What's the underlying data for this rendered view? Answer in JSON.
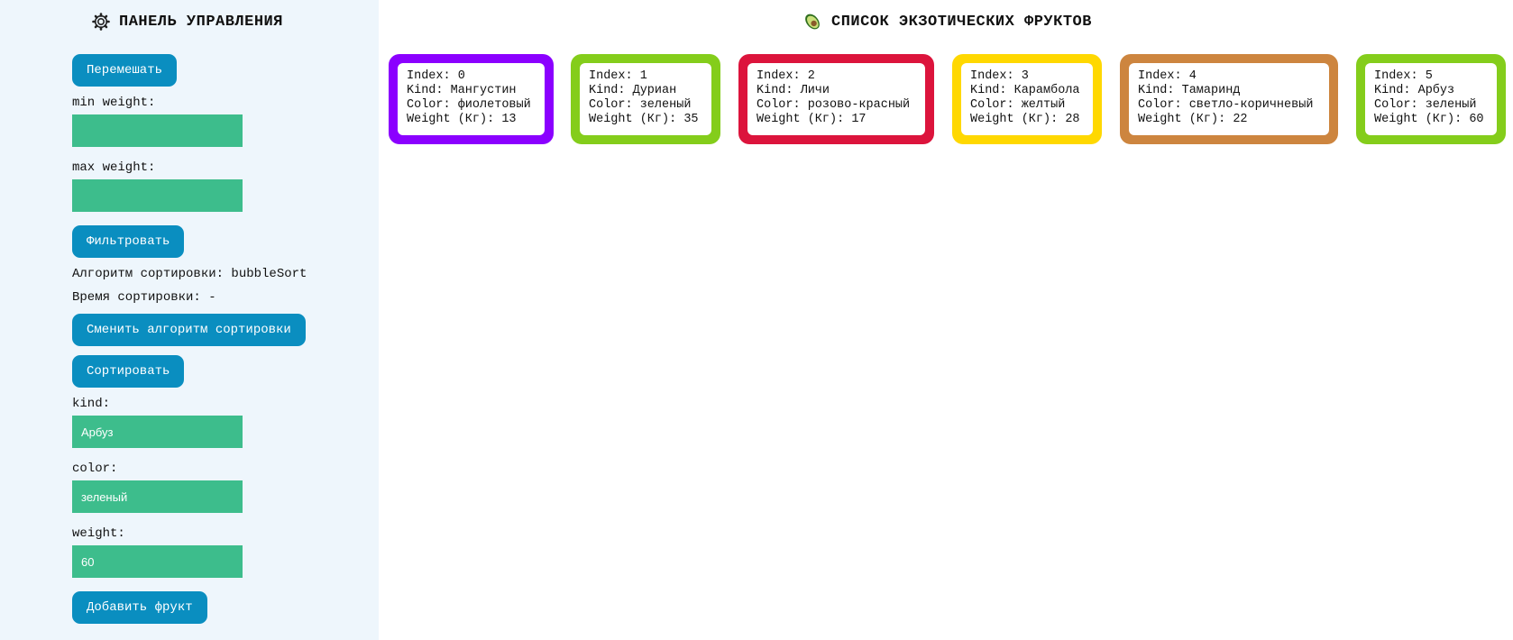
{
  "panel": {
    "title": "ПАНЕЛЬ УПРАВЛЕНИЯ",
    "icon": "gear-icon",
    "shuffle_label": "Перемешать",
    "min_weight_label": "min weight:",
    "min_weight_value": "",
    "max_weight_label": "max weight:",
    "max_weight_value": "",
    "filter_label": "Фильтровать",
    "algorithm_text": "Алгоритм сортировки: bubbleSort",
    "time_text": "Время сортировки: -",
    "change_algorithm_label": "Сменить алгоритм сортировки",
    "sort_label": "Сортировать",
    "kind_label": "kind:",
    "kind_value": "Арбуз",
    "color_label": "color:",
    "color_value": "зеленый",
    "weight_label": "weight:",
    "weight_value": "60",
    "add_label": "Добавить фрукт"
  },
  "main": {
    "title": "СПИСОК ЭКЗОТИЧЕСКИХ ФРУКТОВ",
    "icon": "avocado-icon"
  },
  "colors": {
    "button": "#0a8ec0",
    "input": "#3dbd8c",
    "panel_bg": "#eef6fc"
  },
  "fruits": [
    {
      "index": "Index: 0",
      "kind": "Kind: Мангустин",
      "color": "Color: фиолетовый",
      "weight": "Weight (Кг): 13",
      "border": "#8b00ff"
    },
    {
      "index": "Index: 1",
      "kind": "Kind: Дуриан",
      "color": "Color: зеленый",
      "weight": "Weight (Кг): 35",
      "border": "#84cd1b"
    },
    {
      "index": "Index: 2",
      "kind": "Kind: Личи",
      "color": "Color: розово-красный",
      "weight": "Weight (Кг): 17",
      "border": "#dc143c"
    },
    {
      "index": "Index: 3",
      "kind": "Kind: Карамбола",
      "color": "Color: желтый",
      "weight": "Weight (Кг): 28",
      "border": "#ffd800"
    },
    {
      "index": "Index: 4",
      "kind": "Kind: Тамаринд",
      "color": "Color: светло-коричневый",
      "weight": "Weight (Кг): 22",
      "border": "#cd853f"
    },
    {
      "index": "Index: 5",
      "kind": "Kind: Арбуз",
      "color": "Color: зеленый",
      "weight": "Weight (Кг): 60",
      "border": "#84cd1b"
    }
  ]
}
